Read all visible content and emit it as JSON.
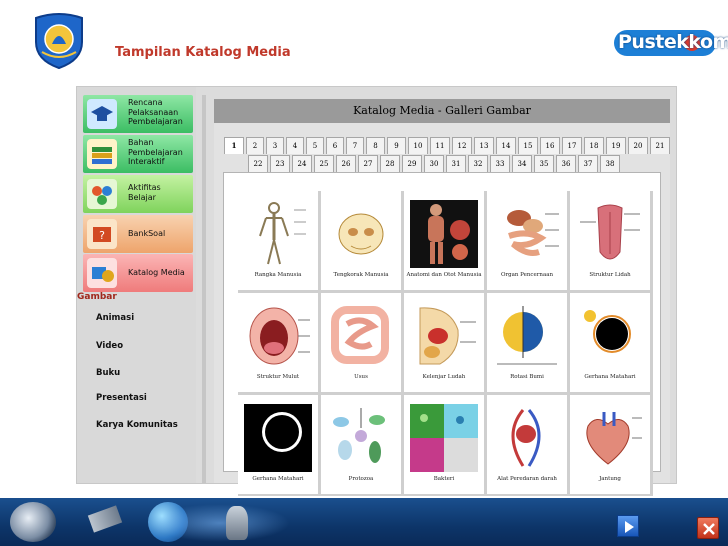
{
  "slide": {
    "title": "Tampilan Katalog Media",
    "logo_text": "Pustekkom"
  },
  "sidebar": {
    "items": [
      {
        "label": "Rencana\nPelaksanaan\nPembelajaran",
        "icon": "graduation-cap-icon",
        "color": "#5ad17a"
      },
      {
        "label": "Bahan\nPembelajaran\nInteraktif",
        "icon": "books-icon",
        "color": "#5ad17a"
      },
      {
        "label": "Aktifitas\nBelajar",
        "icon": "activity-icon",
        "color": "#9be07a"
      },
      {
        "label": "BankSoal",
        "icon": "question-bank-icon",
        "color": "#f2b98a"
      },
      {
        "label": "Katalog Media",
        "icon": "media-catalog-icon",
        "color": "#f49a9a"
      }
    ],
    "section_title": "Gambar",
    "sub_items": [
      "Animasi",
      "Video",
      "Buku",
      "Presentasi",
      "Karya Komunitas"
    ]
  },
  "gallery": {
    "title": "Katalog Media - Galleri Gambar",
    "tabs_row1": [
      "1",
      "2",
      "3",
      "4",
      "5",
      "6",
      "7",
      "8",
      "9",
      "10",
      "11",
      "12",
      "13",
      "14",
      "15",
      "16",
      "17",
      "18",
      "19",
      "20",
      "21"
    ],
    "tabs_row2": [
      "22",
      "23",
      "24",
      "25",
      "26",
      "27",
      "28",
      "29",
      "30",
      "31",
      "32",
      "33",
      "34",
      "35",
      "36",
      "37",
      "38"
    ],
    "active_tab": "1",
    "items": [
      {
        "caption": "Rangka Manusia",
        "icon": "skeleton-icon"
      },
      {
        "caption": "Tengkorak Manusia",
        "icon": "skull-icon"
      },
      {
        "caption": "Anatomi dan Otot Manusia",
        "icon": "muscle-anatomy-icon"
      },
      {
        "caption": "Organ Pencernaan",
        "icon": "digestive-organ-icon"
      },
      {
        "caption": "Struktur Lidah",
        "icon": "tongue-icon"
      },
      {
        "caption": "Struktur Mulut",
        "icon": "mouth-icon"
      },
      {
        "caption": "Usus",
        "icon": "intestine-icon"
      },
      {
        "caption": "Kelenjar Ludah",
        "icon": "salivary-gland-icon"
      },
      {
        "caption": "Rotasi Bumi",
        "icon": "earth-rotation-icon"
      },
      {
        "caption": "Gerhana Matahari",
        "icon": "solar-eclipse-icon"
      },
      {
        "caption": "Gerhana Matahari",
        "icon": "solar-eclipse-icon"
      },
      {
        "caption": "Protozoa",
        "icon": "protozoa-icon"
      },
      {
        "caption": "Bakteri",
        "icon": "bacteria-icon"
      },
      {
        "caption": "Alat Peredaran darah",
        "icon": "circulatory-icon"
      },
      {
        "caption": "Jantung",
        "icon": "heart-icon"
      }
    ]
  }
}
